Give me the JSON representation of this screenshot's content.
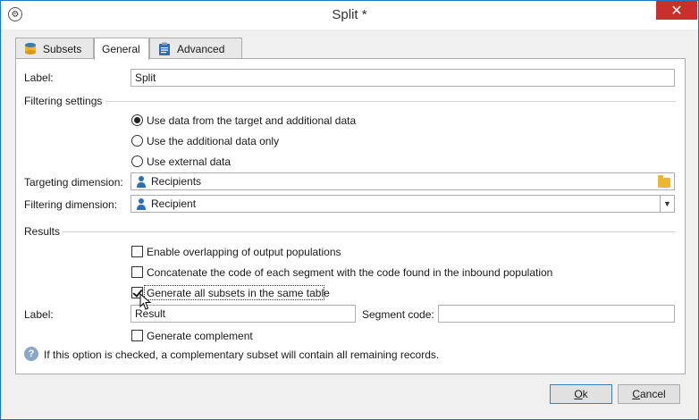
{
  "window": {
    "title": "Split *",
    "app_icon": "workflow-icon",
    "close_glyph": "✕"
  },
  "tabs": [
    {
      "label": "Subsets",
      "icon": "database-icon",
      "active": false
    },
    {
      "label": "General",
      "icon": "",
      "active": true
    },
    {
      "label": "Advanced",
      "icon": "clipboard-icon",
      "active": false
    }
  ],
  "form": {
    "label_caption": "Label:",
    "label_value": "Split",
    "filtering_settings_title": "Filtering settings",
    "radio_options": [
      {
        "label": "Use data from the target and additional data",
        "checked": true
      },
      {
        "label": "Use the additional data only",
        "checked": false
      },
      {
        "label": "Use external data",
        "checked": false
      }
    ],
    "targeting_dimension_caption": "Targeting dimension:",
    "targeting_dimension_value": "Recipients",
    "filtering_dimension_caption": "Filtering dimension:",
    "filtering_dimension_value": "Recipient",
    "results_title": "Results",
    "checkboxes": [
      {
        "label": "Enable overlapping of output populations",
        "checked": false
      },
      {
        "label": "Concatenate the code of each segment with the code found in the inbound population",
        "checked": false
      },
      {
        "label": "Generate all subsets in the same table",
        "checked": true
      }
    ],
    "result_label_caption": "Label:",
    "result_label_value": "Result",
    "segment_code_caption": "Segment code:",
    "segment_code_value": "",
    "generate_complement_label": "Generate complement",
    "generate_complement_checked": false,
    "help_text": "If this option is checked, a complementary subset will contain all remaining records."
  },
  "buttons": {
    "ok_first": "O",
    "ok_rest": "k",
    "cancel_first": "C",
    "cancel_rest": "ancel"
  },
  "colors": {
    "accent_border": "#1e76bf",
    "close_button": "#c7302b",
    "person_icon": "#2a6ebb",
    "folder_icon": "#e8b830"
  }
}
